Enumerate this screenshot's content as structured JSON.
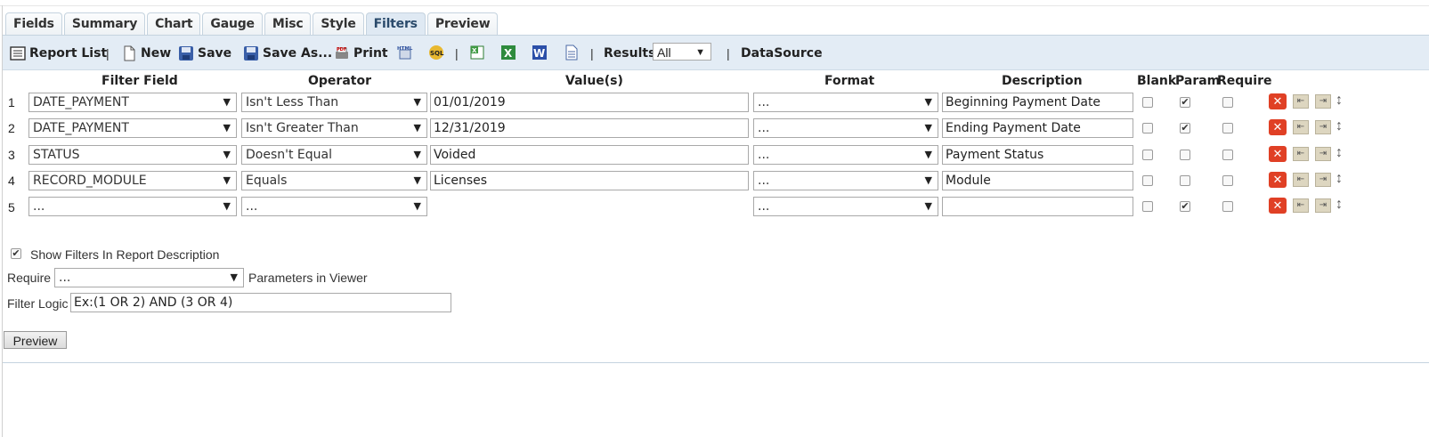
{
  "tabs": [
    "Fields",
    "Summary",
    "Chart",
    "Gauge",
    "Misc",
    "Style",
    "Filters",
    "Preview"
  ],
  "active_tab": "Filters",
  "toolbar": {
    "report_list": "Report List",
    "new": "New",
    "save": "Save",
    "save_as": "Save As...",
    "print": "Print",
    "results_label": "Results",
    "results_value": "All",
    "datasource": "DataSource",
    "sep": "|",
    "pdf_tag": "PDF",
    "html_tag": "HTML",
    "sql_tag": "SQL",
    "excel_tag": "X",
    "word_tag": "W"
  },
  "headers": {
    "filter_field": "Filter Field",
    "operator": "Operator",
    "values": "Value(s)",
    "format": "Format",
    "description": "Description",
    "blank": "Blank",
    "param": "Param",
    "require": "Require"
  },
  "rows": [
    {
      "num": "1",
      "field": "DATE_PAYMENT",
      "operator": "Isn't Less Than",
      "value": "01/01/2019",
      "format": "...",
      "description": "Beginning Payment Date",
      "blank": false,
      "param": true,
      "require": false
    },
    {
      "num": "2",
      "field": "DATE_PAYMENT",
      "operator": "Isn't Greater Than",
      "value": "12/31/2019",
      "format": "...",
      "description": "Ending Payment Date",
      "blank": false,
      "param": true,
      "require": false
    },
    {
      "num": "3",
      "field": "STATUS",
      "operator": "Doesn't Equal",
      "value": "Voided",
      "format": "...",
      "description": "Payment Status",
      "blank": false,
      "param": false,
      "require": false
    },
    {
      "num": "4",
      "field": "RECORD_MODULE",
      "operator": "Equals",
      "value": "Licenses",
      "format": "...",
      "description": "Module",
      "blank": false,
      "param": false,
      "require": false
    },
    {
      "num": "5",
      "field": "...",
      "operator": "...",
      "value": "",
      "format": "...",
      "description": "",
      "blank": false,
      "param": true,
      "require": false
    }
  ],
  "options": {
    "show_filters_label": "Show Filters In Report Description",
    "show_filters_checked": true,
    "require_label": "Require",
    "require_value": "...",
    "parameters_label": "Parameters in Viewer",
    "filter_logic_label": "Filter Logic",
    "filter_logic_placeholder": "Ex:(1 OR 2) AND (3 OR 4)"
  },
  "preview_button": "Preview",
  "glyphs": {
    "dropdown": "▼",
    "check": "✔",
    "delete": "✕",
    "move_up": "⇤",
    "move_down": "⇥",
    "drag": "↕"
  },
  "colors": {
    "toolbar_bg": "#e3ecf5",
    "delete_red": "#e04025",
    "tab_active": "#dfe9f3"
  }
}
